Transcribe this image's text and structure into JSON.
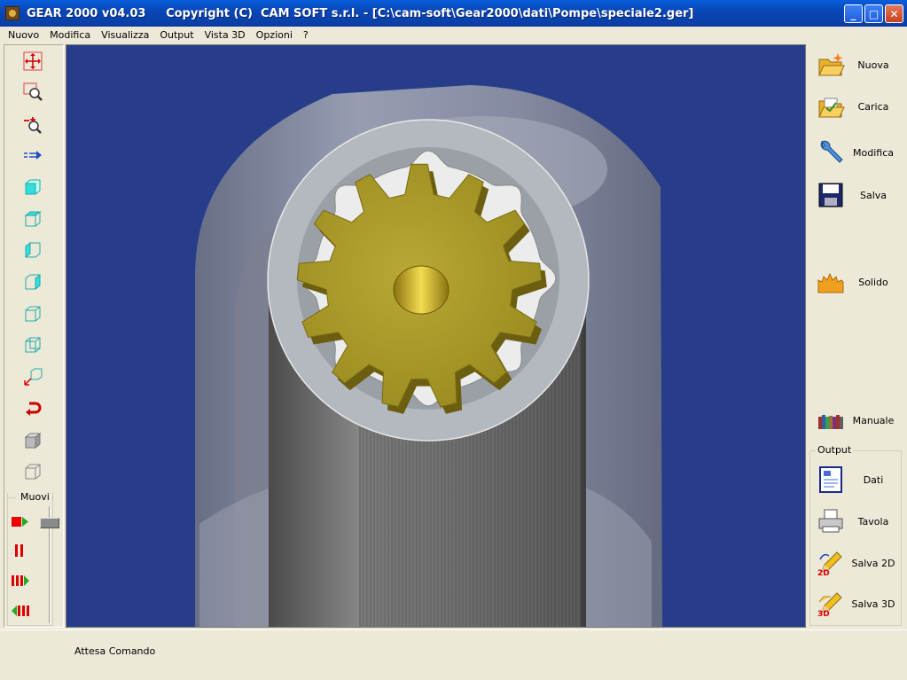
{
  "window": {
    "title": "GEAR 2000 v04.03     Copyright (C)  CAM SOFT s.r.l. - [C:\\cam-soft\\Gear2000\\dati\\Pompe\\speciale2.ger]",
    "minimize_glyph": "_",
    "maximize_glyph": "□",
    "close_glyph": "✕"
  },
  "menu": {
    "items": [
      "Nuovo",
      "Modifica",
      "Visualizza",
      "Output",
      "Vista 3D",
      "Opzioni",
      "?"
    ]
  },
  "left_toolbar": {
    "tools": [
      {
        "icon": "pan-icon"
      },
      {
        "icon": "zoom-window-icon"
      },
      {
        "icon": "zoom-in-out-icon"
      },
      {
        "icon": "arrow-right-icon"
      },
      {
        "icon": "cube-front-icon"
      },
      {
        "icon": "cube-top-icon"
      },
      {
        "icon": "cube-side-icon"
      },
      {
        "icon": "cube-right-icon"
      },
      {
        "icon": "cube-wireframe-icon"
      },
      {
        "icon": "cube-wireframe-2-icon"
      },
      {
        "icon": "axis-rotate-icon"
      },
      {
        "icon": "undo-arrow-icon"
      },
      {
        "icon": "solid-cube-icon"
      },
      {
        "icon": "wire-cube-icon"
      }
    ],
    "muovi": {
      "label": "Muovi",
      "controls": [
        "play-icon",
        "pause-icon",
        "fast-forward-icon",
        "rewind-icon"
      ]
    }
  },
  "right_panel": {
    "buttons": [
      {
        "label": "Nuova",
        "icon": "new-folder-icon"
      },
      {
        "label": "Carica",
        "icon": "load-icon"
      },
      {
        "label": "Modifica",
        "icon": "wrench-icon"
      },
      {
        "label": "Salva",
        "icon": "floppy-icon"
      },
      {
        "label": "Solido",
        "icon": "solid-icon"
      },
      {
        "label": "Manuale",
        "icon": "books-icon"
      }
    ],
    "output": {
      "label": "Output",
      "buttons": [
        {
          "label": "Dati",
          "icon": "data-sheet-icon"
        },
        {
          "label": "Tavola",
          "icon": "printer-icon"
        },
        {
          "label": "Salva 2D",
          "icon": "pencil-2d-icon",
          "badge": "2D"
        },
        {
          "label": "Salva 3D",
          "icon": "pencil-3d-icon",
          "badge": "3D"
        }
      ]
    }
  },
  "status": {
    "text": "Attesa Comando"
  },
  "colors": {
    "viewport_bg": "#273d8a",
    "gear": "#c9b43a",
    "housing": "#9a9aa6"
  }
}
